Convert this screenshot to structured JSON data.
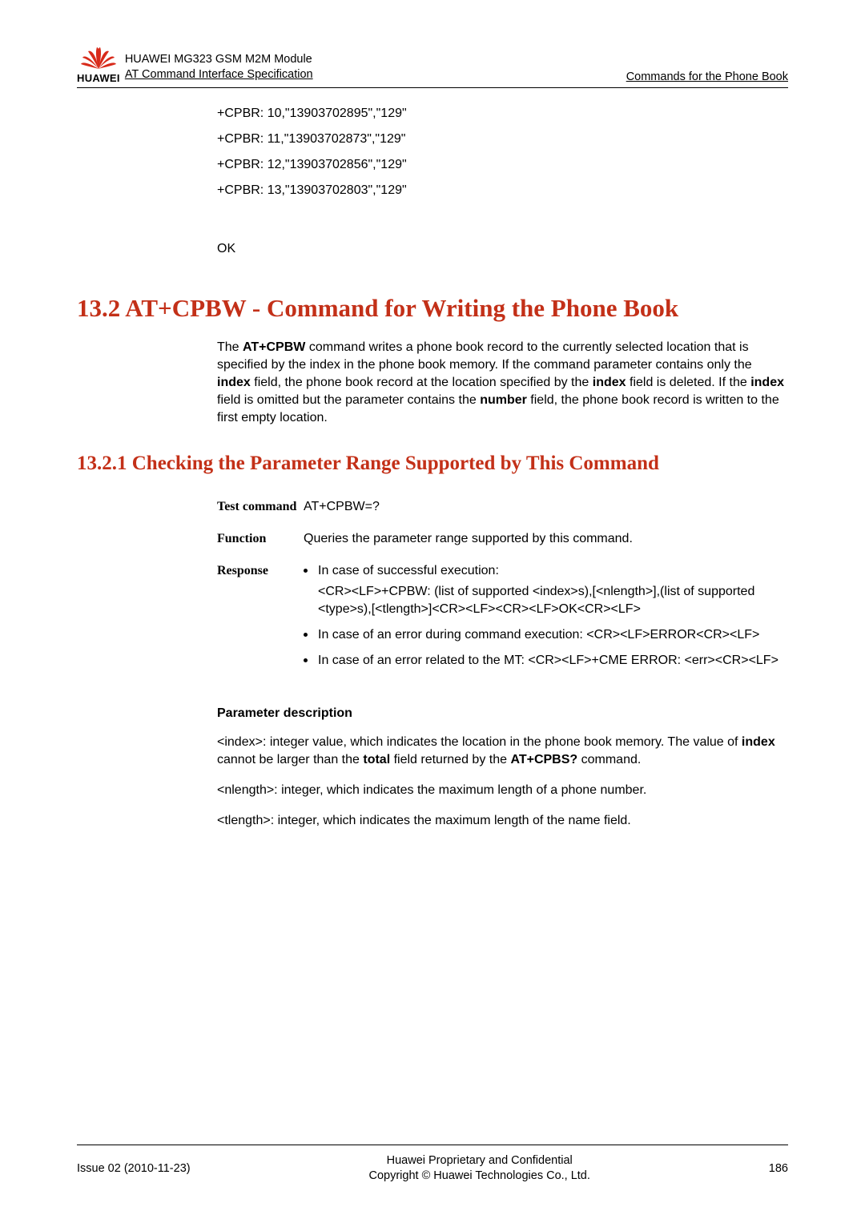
{
  "header": {
    "line1": "HUAWEI MG323 GSM M2M Module",
    "line2": "AT Command Interface Specification",
    "right": "Commands for the Phone Book",
    "logo_text": "HUAWEI"
  },
  "example": {
    "lines": [
      "+CPBR: 10,\"13903702895\",\"129\"",
      "+CPBR: 11,\"13903702873\",\"129\"",
      "+CPBR: 12,\"13903702856\",\"129\"",
      "+CPBR: 13,\"13903702803\",\"129\""
    ],
    "ok": "OK"
  },
  "section": {
    "title": "13.2 AT+CPBW - Command for Writing the Phone Book",
    "desc_pre": "The ",
    "desc_cmd": "AT+CPBW",
    "desc_a": " command writes a phone book record to the currently selected location that is specified by the index in the phone book memory. If the command parameter contains only the ",
    "desc_index1": "index",
    "desc_b": " field, the phone book record at the location specified by the ",
    "desc_index2": "index",
    "desc_c": " field is deleted. If the ",
    "desc_index3": "index",
    "desc_d": " field is omitted but the parameter contains the ",
    "desc_number": "number",
    "desc_e": " field, the phone book record is written to the first empty location."
  },
  "subsection": {
    "title": "13.2.1 Checking the Parameter Range Supported by This Command"
  },
  "defs": {
    "row1_label": "Test command",
    "row1_value": "AT+CPBW=?",
    "row2_label": "Function",
    "row2_value": "Queries the parameter range supported by this command.",
    "row3_label": "Response",
    "b1_head": "In case of successful execution:",
    "b1_body": "<CR><LF>+CPBW: (list of supported <index>s),[<nlength>],(list of supported <type>s),[<tlength>]<CR><LF><CR><LF>OK<CR><LF>",
    "b2_head": "In case of an error during command execution: <CR><LF>ERROR<CR><LF>",
    "b3_head": "In case of an error related to the MT: <CR><LF>+CME ERROR: <err><CR><LF>"
  },
  "params": {
    "title": "Parameter description",
    "p1_a": "<index>: integer value, which indicates the location in the phone book memory. The value of ",
    "p1_b": "index",
    "p1_c": " cannot be larger than the ",
    "p1_d": "total",
    "p1_e": " field returned by the ",
    "p1_f": "AT+CPBS?",
    "p1_g": " command.",
    "p2": "<nlength>: integer, which indicates the maximum length of a phone number.",
    "p3": "<tlength>: integer, which indicates the maximum length of the name field."
  },
  "footer": {
    "left": "Issue 02 (2010-11-23)",
    "center1": "Huawei Proprietary and Confidential",
    "center2": "Copyright © Huawei Technologies Co., Ltd.",
    "right": "186"
  }
}
